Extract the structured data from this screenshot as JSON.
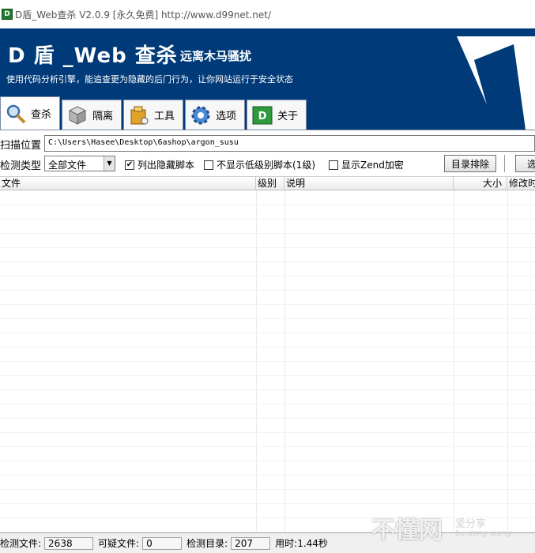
{
  "window": {
    "title": "D盾_Web查杀 V2.0.9 [永久免费] http://www.d99net.net/"
  },
  "banner": {
    "title": "D 盾 _Web 查杀",
    "subtitle": "远离木马骚扰",
    "description": "使用代码分析引擎，能追查更为隐藏的后门行为，让你网站运行于安全状态"
  },
  "tabs": [
    {
      "label": "查杀",
      "icon": "magnifier-icon"
    },
    {
      "label": "隔离",
      "icon": "box-icon"
    },
    {
      "label": "工具",
      "icon": "folder-icon"
    },
    {
      "label": "选项",
      "icon": "gear-icon"
    },
    {
      "label": "关于",
      "icon": "info-d-icon"
    }
  ],
  "scan": {
    "path_label": "扫描位置",
    "path_value": "C:\\Users\\Hasee\\Desktop\\6ashop\\argon_susu",
    "type_label": "检测类型",
    "type_value": "全部文件",
    "cb_hidden": "列出隐藏脚本",
    "cb_low": "不显示低级别脚本(1级)",
    "cb_zend": "显示Zend加密",
    "btn_exclude": "目录排除",
    "btn_select": "选"
  },
  "table": {
    "columns": [
      "文件",
      "级别",
      "说明",
      "大小",
      "修改时"
    ]
  },
  "status": {
    "files_label": "检测文件:",
    "files_value": "2638",
    "suspect_label": "可疑文件:",
    "suspect_value": "0",
    "dirs_label": "检测目录:",
    "dirs_value": "207",
    "time_label": "用时:",
    "time_value": "1.44秒"
  },
  "watermark": {
    "main": "不懂网",
    "cn": "爱分享",
    "en": "bu dong wang"
  },
  "colors": {
    "banner": "#003a78",
    "app_icon": "#1e7a2e"
  }
}
